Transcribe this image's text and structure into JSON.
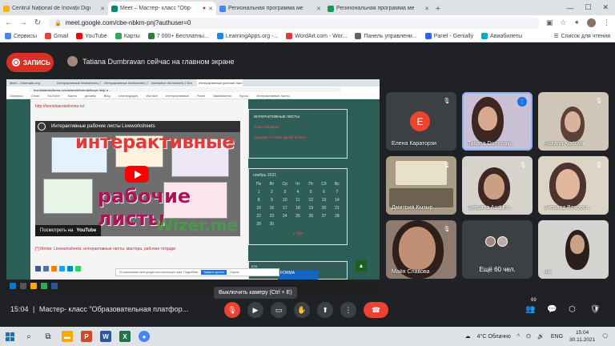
{
  "browser": {
    "tabs": [
      {
        "title": "Centrul Național de Inovații Digi",
        "color": "#f4b400",
        "active": false
      },
      {
        "title": "Meet – Мастер- класс \"Обр",
        "color": "#00897b",
        "active": true
      },
      {
        "title": "Региональная программа ме",
        "color": "#4285f4",
        "active": false
      },
      {
        "title": "Регинональная программа ме",
        "color": "#0f9d58",
        "active": false
      }
    ],
    "url": "meet.google.com/cbe-nbkm-pnj?authuser=0",
    "bookmarks": [
      {
        "label": "Сервисы",
        "color": "#4285f4"
      },
      {
        "label": "Gmail",
        "color": "#ea4335"
      },
      {
        "label": "YouTube",
        "color": "#ff0000"
      },
      {
        "label": "Карты",
        "color": "#34a853"
      },
      {
        "label": "7 000+ Бесплатны...",
        "color": "#2e7d32"
      },
      {
        "label": "LearningApps.org -...",
        "color": "#1e88e5"
      },
      {
        "label": "WordArt.com - Wor...",
        "color": "#e53935"
      },
      {
        "label": "Панель управлени...",
        "color": "#616161"
      },
      {
        "label": "Panel - Genially",
        "color": "#2962ff"
      },
      {
        "label": "Авиабилеты",
        "color": "#00acc1"
      }
    ],
    "reading_list": "Список для чтения"
  },
  "meet": {
    "record_label": "ЗАПИСЬ",
    "presenter_text": "Tatiana Dumbravan сейчас на главном экране",
    "time": "15:04",
    "separator": "|",
    "meeting_title": "Мастер- класс \"Образовательная платфор...",
    "tooltip": "Выключить камеру (Ctrl + E)",
    "participants_badge": "69"
  },
  "shared_screen": {
    "tabs": [
      "Meet – Informatic.org",
      "Интерактивные Worksheets | Wor",
      "Интерактивные Worksheets | Wor",
      "Interactive Worksheets | Wor",
      "Интерактивные рабочие листы"
    ],
    "url": "leonidaanatolievna.ru/nastavniki/interaktivnye-listy/ и ...",
    "bookmarks": [
      "Сервисы",
      "Gmail",
      "YouTube",
      "Карты",
      "genially",
      "Blog",
      "LearningApps",
      "WordArt",
      "Интерактивные",
      "Panel",
      "Авиабилеты",
      "Курсы",
      "Интерактивные листы"
    ],
    "link": "http://leonidaanatolievna.ru/",
    "video_title": "Интерактивные рабочие листы Liveworksheets",
    "big_text_1": "интерактивные",
    "big_text_2": "рабочие листы",
    "big_text_3": "Wizer.me",
    "watch_on": "Посмотреть на",
    "youtube": "YouTube",
    "caption": "[*] Метки: Liveworksheets, интерактивные листы, мастера, рабочие тетради",
    "side_items": [
      "ИНТЕРАКТИВНЫЕ ЛИСТЫ",
      "Поиск-Задания",
      "Задание по теме Дробь и класс"
    ],
    "calendar_title": "ноябрь 2021",
    "calendar_days": [
      "Пн",
      "Вт",
      "Ср",
      "Чт",
      "Пт",
      "Сб",
      "Вс"
    ],
    "calendar_dates": [
      "1",
      "2",
      "3",
      "4",
      "5",
      "6",
      "7",
      "8",
      "9",
      "10",
      "11",
      "12",
      "13",
      "14",
      "15",
      "16",
      "17",
      "18",
      "19",
      "20",
      "21",
      "22",
      "23",
      "24",
      "25",
      "26",
      "27",
      "28",
      "29",
      "30"
    ],
    "calendar_prev": "« Окт",
    "side2_label": "КТК",
    "side2_img": "FORMA",
    "cookie_text": "По умолчанию meet.google.com использует куки. Подробнее",
    "cookie_ok": "Закрыть доступ",
    "cookie_extra": "Скрыть"
  },
  "participants": [
    {
      "name": "Елена Караторзи",
      "type": "letter",
      "letter": "E"
    },
    {
      "name": "Tatiana Dumbrav...",
      "type": "video"
    },
    {
      "name": "Roxana Kortova",
      "type": "video"
    },
    {
      "name": "Дмитрий Кызыр...",
      "type": "video"
    },
    {
      "name": "Svetlana Anduro...",
      "type": "video"
    },
    {
      "name": "Svetlana Bespeci...",
      "type": "video"
    },
    {
      "name": "Майя Славова",
      "type": "video"
    },
    {
      "name": "Ещё 60 чел.",
      "type": "more"
    },
    {
      "name": "Вы",
      "type": "video"
    }
  ],
  "taskbar": {
    "weather": "4°C Облачно",
    "lang": "ENG",
    "time": "15:04",
    "date": "30.11.2021"
  }
}
